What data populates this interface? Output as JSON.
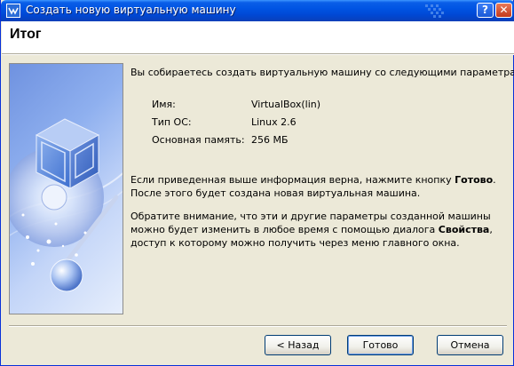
{
  "window": {
    "title": "Создать новую виртуальную машину",
    "help_label": "?",
    "close_label": "✕"
  },
  "header": {
    "title": "Итог"
  },
  "content": {
    "intro": "Вы собираетесь создать виртуальную машину со следующими параметрами:",
    "params": [
      {
        "label": "Имя:",
        "value": "VirtualBox(lin)"
      },
      {
        "label": "Тип ОС:",
        "value": "Linux 2.6"
      },
      {
        "label": "Основная память:",
        "value": "256 МБ"
      }
    ],
    "para1_a": "Если приведенная выше информация верна, нажмите кнопку ",
    "para1_bold": "Готово",
    "para1_b": ". После этого будет создана новая виртуальная машина.",
    "para2_a": "Обратите внимание, что эти и другие параметры созданной машины можно будет изменить в любое время с помощью диалога ",
    "para2_bold": "Свойства",
    "para2_b": ", доступ к которому можно получить через меню главного окна."
  },
  "buttons": {
    "back": "< Назад",
    "finish": "Готово",
    "cancel": "Отмена"
  },
  "colors": {
    "titlebar": "#0054e3",
    "dialog_bg": "#ece9d8",
    "header_bg": "#ffffff",
    "button_border": "#003c74"
  }
}
